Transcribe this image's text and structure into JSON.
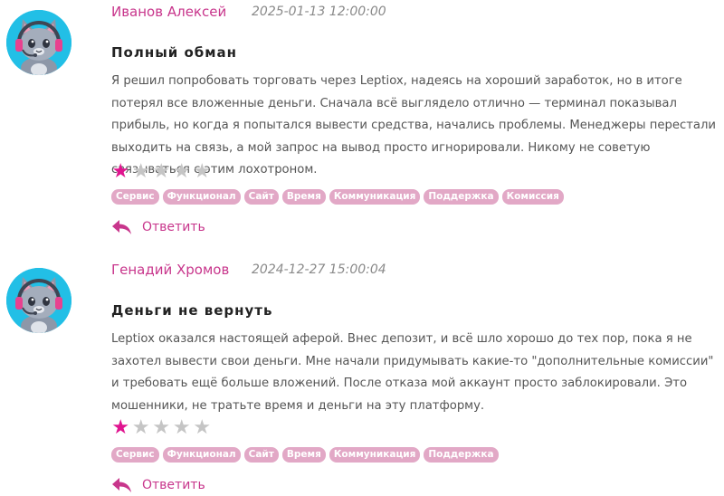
{
  "reviews": [
    {
      "author": "Иванов Алексей",
      "date": "2025-01-13 12:00:00",
      "title": "Полный обман",
      "body": "Я решил попробовать торговать через Leptiox, надеясь на хороший заработок, но в итоге потерял все вложенные деньги. Сначала всё выглядело отлично — терминал показывал прибыль, но когда я попытался вывести средства, начались проблемы. Менеджеры перестали выходить на связь, а мой запрос на вывод просто игнорировали. Никому не советую связываться с этим лохотроном.",
      "rating": 1,
      "rating_max": 5,
      "tags": [
        "Сервис",
        "Функционал",
        "Сайт",
        "Время",
        "Коммуникация",
        "Поддержка",
        "Комиссия"
      ],
      "reply_label": "Ответить"
    },
    {
      "author": "Генадий Хромов",
      "date": "2024-12-27 15:00:04",
      "title": "Деньги не вернуть",
      "body": "Leptiox оказался настоящей аферой. Внес депозит, и всё шло хорошо до тех пор, пока я не захотел вывести свои деньги. Мне начали придумывать какие-то \"дополнительные комиссии\" и требовать ещё больше вложений. После отказа мой аккаунт просто заблокировали. Это мошенники, не тратьте время и деньги на эту платформу.",
      "rating": 1,
      "rating_max": 5,
      "tags": [
        "Сервис",
        "Функционал",
        "Сайт",
        "Время",
        "Коммуникация",
        "Поддержка"
      ],
      "reply_label": "Ответить"
    }
  ],
  "colors": {
    "author": "#c8368c",
    "star_on": "#e0148f",
    "star_off": "#c5c5c5",
    "tag_bg": "#e2a8c6",
    "avatar_bg": "#22bfe6"
  },
  "icons": {
    "avatar": "cat-gamer-avatar-icon",
    "reply": "reply-arrow-icon",
    "star": "star-icon"
  }
}
